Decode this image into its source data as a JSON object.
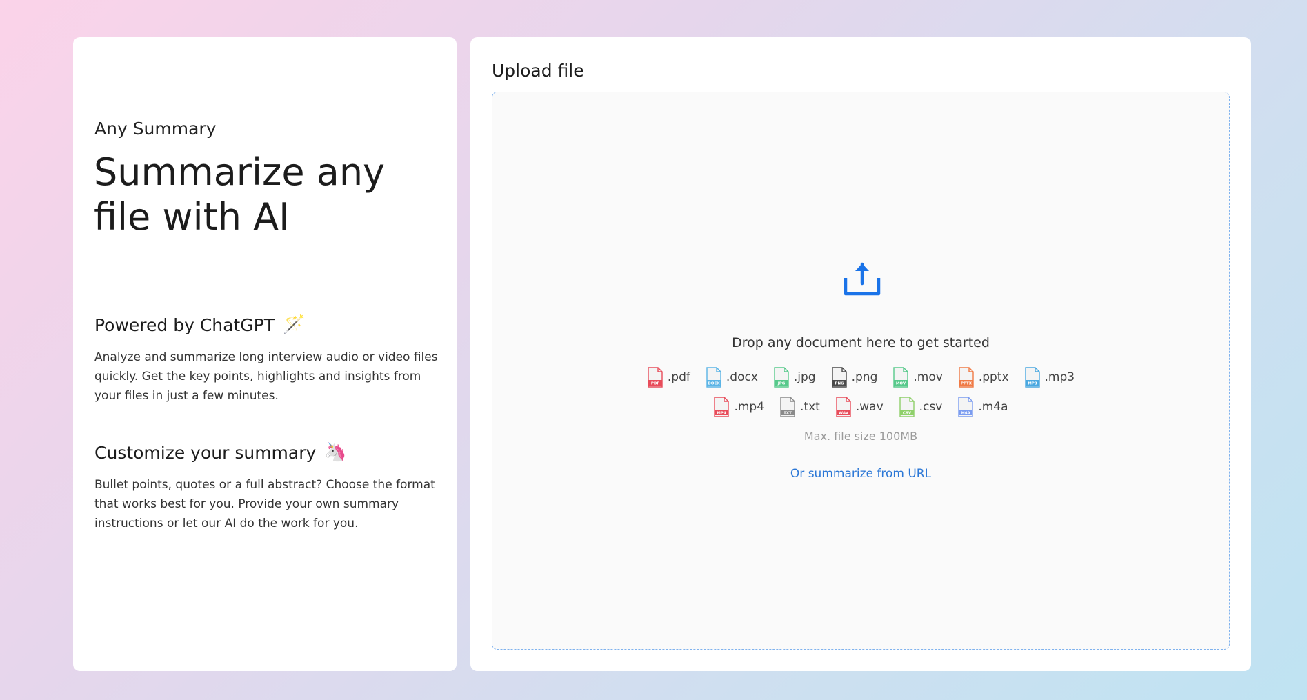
{
  "intro": {
    "app_name": "Any Summary",
    "headline": "Summarize any file with AI"
  },
  "features": [
    {
      "title": "Powered by ChatGPT",
      "emoji": "🪄",
      "description": "Analyze and summarize long interview audio or video files quickly. Get the key points, highlights and insights from your files in just a few minutes."
    },
    {
      "title": "Customize your summary",
      "emoji": "🦄",
      "description": "Bullet points, quotes or a full abstract? Choose the format that works best for you. Provide your own summary instructions or let our AI do the work for you."
    }
  ],
  "upload": {
    "title": "Upload file",
    "drop_text": "Drop any document here to get started",
    "max_size": "Max. file size 100MB",
    "url_link": "Or summarize from URL",
    "accent_color": "#1a73e8",
    "file_types": [
      {
        "ext": ".pdf",
        "tag": "PDF",
        "color": "#e84c5a"
      },
      {
        "ext": ".docx",
        "tag": "DOCX",
        "color": "#5ab4e6"
      },
      {
        "ext": ".jpg",
        "tag": "JPG",
        "color": "#57c98b"
      },
      {
        "ext": ".png",
        "tag": "PNG",
        "color": "#4a4a4a"
      },
      {
        "ext": ".mov",
        "tag": "MOV",
        "color": "#57c98b"
      },
      {
        "ext": ".pptx",
        "tag": "PPTX",
        "color": "#f07a45"
      },
      {
        "ext": ".mp3",
        "tag": "MP3",
        "color": "#4aa8e0"
      },
      {
        "ext": ".mp4",
        "tag": "MP4",
        "color": "#e84c5a"
      },
      {
        "ext": ".txt",
        "tag": "TXT",
        "color": "#8a8a8a"
      },
      {
        "ext": ".wav",
        "tag": "WAV",
        "color": "#e84c5a"
      },
      {
        "ext": ".csv",
        "tag": "CSV",
        "color": "#8fd06a"
      },
      {
        "ext": ".m4a",
        "tag": "M4A",
        "color": "#7b9cf0"
      }
    ]
  }
}
